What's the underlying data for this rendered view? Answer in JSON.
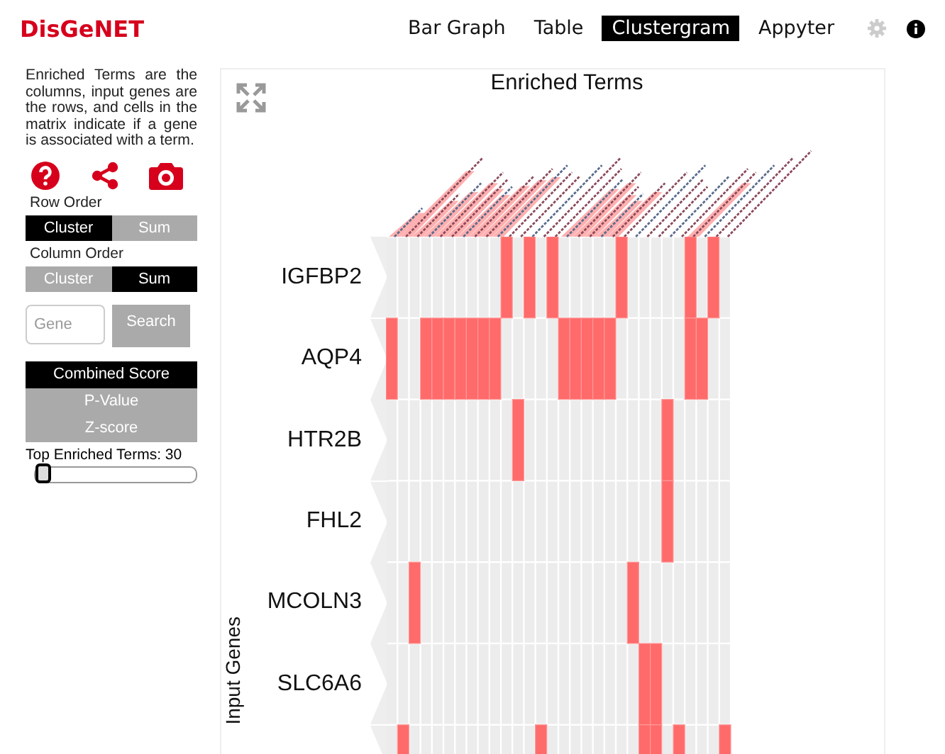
{
  "logo": "DisGeNET",
  "nav": [
    {
      "label": "Bar Graph",
      "selected": false
    },
    {
      "label": "Table",
      "selected": false
    },
    {
      "label": "Clustergram",
      "selected": true
    },
    {
      "label": "Appyter",
      "selected": false
    }
  ],
  "sidebar": {
    "description": "Enriched Terms are the columns, input genes are the rows, and cells in the matrix indicate if a gene is associated with a term.",
    "row_order": {
      "label": "Row Order",
      "options": [
        {
          "label": "Cluster",
          "selected": true
        },
        {
          "label": "Sum",
          "selected": false
        }
      ]
    },
    "column_order": {
      "label": "Column Order",
      "options": [
        {
          "label": "Cluster",
          "selected": false
        },
        {
          "label": "Sum",
          "selected": true
        }
      ]
    },
    "gene_search": {
      "placeholder": "Gene",
      "button": "Search"
    },
    "score_options": [
      {
        "label": "Combined Score",
        "selected": true
      },
      {
        "label": "P-Value",
        "selected": false
      },
      {
        "label": "Z-score",
        "selected": false
      }
    ],
    "top_terms": {
      "label": "Top Enriched Terms: 30",
      "level": 0
    }
  },
  "clustergram": {
    "title": "Enriched Terms",
    "axis_label": "Input Genes",
    "rows": [
      {
        "gene": "IGFBP2",
        "cells": [
          false,
          false,
          false,
          false,
          false,
          false,
          false,
          false,
          false,
          false,
          true,
          false,
          true,
          false,
          true,
          false,
          false,
          false,
          false,
          false,
          true,
          false,
          false,
          false,
          false,
          false,
          true,
          false,
          true,
          false
        ]
      },
      {
        "gene": "AQP4",
        "cells": [
          true,
          false,
          false,
          true,
          true,
          true,
          true,
          true,
          true,
          true,
          false,
          false,
          false,
          false,
          false,
          true,
          true,
          true,
          true,
          true,
          false,
          false,
          false,
          false,
          false,
          false,
          true,
          true,
          false,
          false
        ]
      },
      {
        "gene": "HTR2B",
        "cells": [
          false,
          false,
          false,
          false,
          false,
          false,
          false,
          false,
          false,
          false,
          false,
          true,
          false,
          false,
          false,
          false,
          false,
          false,
          false,
          false,
          false,
          false,
          false,
          false,
          true,
          false,
          false,
          false,
          false,
          false
        ]
      },
      {
        "gene": "FHL2",
        "cells": [
          false,
          false,
          false,
          false,
          false,
          false,
          false,
          false,
          false,
          false,
          false,
          false,
          false,
          false,
          false,
          false,
          false,
          false,
          false,
          false,
          false,
          false,
          false,
          false,
          true,
          false,
          false,
          false,
          false,
          false
        ]
      },
      {
        "gene": "MCOLN3",
        "cells": [
          false,
          false,
          true,
          false,
          false,
          false,
          false,
          false,
          false,
          false,
          false,
          false,
          false,
          false,
          false,
          false,
          false,
          false,
          false,
          false,
          false,
          true,
          false,
          false,
          false,
          false,
          false,
          false,
          false,
          false
        ]
      },
      {
        "gene": "SLC6A6",
        "cells": [
          false,
          false,
          false,
          false,
          false,
          false,
          false,
          false,
          false,
          false,
          false,
          false,
          false,
          false,
          false,
          false,
          false,
          false,
          false,
          false,
          false,
          false,
          true,
          true,
          false,
          false,
          false,
          false,
          false,
          false
        ]
      },
      {
        "cells": [
          false,
          true,
          false,
          false,
          false,
          false,
          false,
          false,
          false,
          false,
          false,
          false,
          false,
          true,
          false,
          false,
          false,
          false,
          false,
          false,
          false,
          false,
          true,
          true,
          false,
          true,
          false,
          false,
          false,
          true
        ]
      }
    ]
  }
}
